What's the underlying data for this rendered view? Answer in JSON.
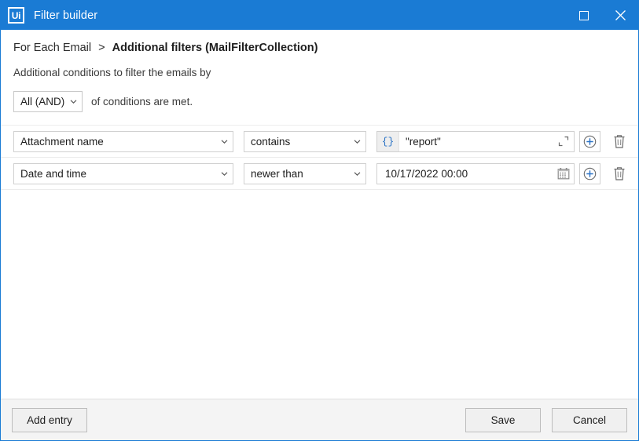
{
  "window": {
    "title": "Filter builder",
    "logo_text": "Ui",
    "accent_color": "#1a7bd4",
    "buttons": {
      "maximize": "maximize-button",
      "close": "close-button"
    }
  },
  "breadcrumb": {
    "root": "For Each Email",
    "separator": ">",
    "current": "Additional filters (MailFilterCollection)"
  },
  "subtitle": "Additional conditions to filter the emails by",
  "logic": {
    "selected": "All (AND)",
    "trailing_text": "of conditions are met."
  },
  "conditions": {
    "rows": [
      {
        "field": "Attachment name",
        "operator": "contains",
        "value": "\"report\"",
        "value_prefix": "{}",
        "value_icon": "expand-icon",
        "add_label": "+",
        "delete_label": "delete-icon"
      },
      {
        "field": "Date and time",
        "operator": "newer than",
        "value": "10/17/2022 00:00",
        "value_prefix": "",
        "value_icon": "calendar-icon",
        "add_label": "+",
        "delete_label": "delete-icon"
      }
    ]
  },
  "footer": {
    "add_entry": "Add entry",
    "save": "Save",
    "cancel": "Cancel"
  }
}
